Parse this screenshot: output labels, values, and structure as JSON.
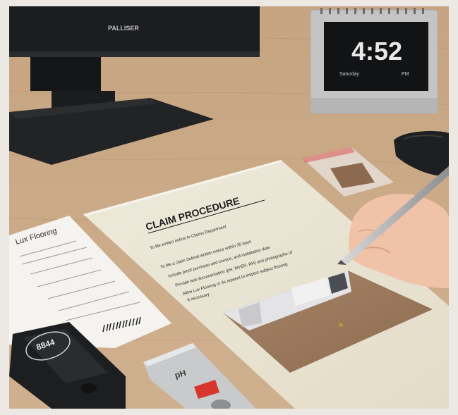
{
  "monitor": {
    "brand": "PALLISER"
  },
  "clock": {
    "time": "4:52",
    "day": "Saturday",
    "ampm": "PM"
  },
  "receipt": {
    "store": "Lux Flooring"
  },
  "document": {
    "title": "CLAIM PROCEDURE",
    "bullets": [
      "To file written notice to Claims Department",
      "To file a claim Submit written notice within 30 days",
      "Include proof purchase and invoice, and installation date",
      "Provide test documentation (pH, MVER, RH) and photographs of",
      "Allow Lux Flooring or its repsent to inspect subject flooring",
      "If necessary"
    ]
  },
  "moisture_meter": {
    "reading": "8844"
  },
  "ph_meter": {
    "label": "pH"
  },
  "colors": {
    "desk": "#c9a784",
    "paper": "#ece7d7",
    "ink": "#2a2a2a",
    "ph_red": "#d8352c"
  }
}
